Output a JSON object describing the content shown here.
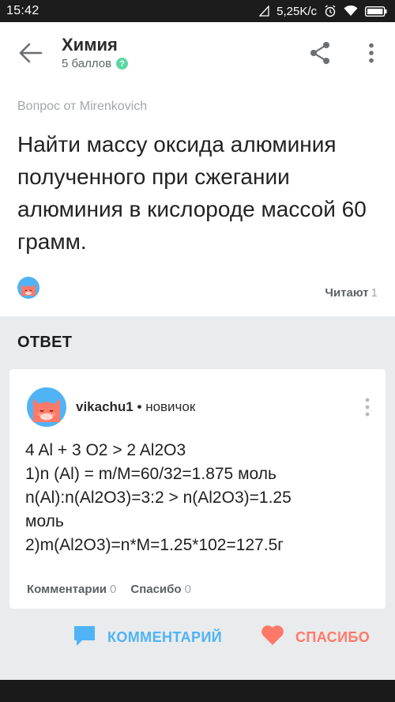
{
  "status_bar": {
    "time": "15:42",
    "speed": "5,25K/c",
    "battery": "",
    "icons": [
      "sim-empty-icon",
      "alarm-icon",
      "wifi-icon",
      "battery-icon"
    ]
  },
  "app_bar": {
    "title": "Химия",
    "points": "5 баллов",
    "help_symbol": "?",
    "icons": [
      "back-arrow-icon",
      "share-icon",
      "more-vertical-icon"
    ]
  },
  "question": {
    "from": "Вопрос от Mirenkovich",
    "text": "Найти массу оксида алюминия полученного при сжегании алюминия в кислороде массой 60 грамм.",
    "readers_label": "Читают",
    "readers_count": "1"
  },
  "answer_section": {
    "header": "ОТВЕТ"
  },
  "answer": {
    "username": "vikachu1",
    "separator": "•",
    "rank": "новичок",
    "lines": [
      "4 Al + 3 O2 > 2 Al2O3",
      "1)n (Al) = m/M=60/32=1.875 моль",
      "n(Al):n(Al2O3)=3:2 > n(Al2O3)=1.25",
      "моль",
      "2)m(Al2O3)=n*M=1.25*102=127.5г"
    ],
    "comments_label": "Комментарии",
    "comments_count": "0",
    "thanks_label": "Спасибо",
    "thanks_count": "0"
  },
  "actions": {
    "comment_label": "КОММЕНТАРИЙ",
    "thanks_label": "СПАСИБО"
  },
  "colors": {
    "accent_blue": "#4fb3f6",
    "accent_red": "#ff7968",
    "accent_green": "#5bd6a4",
    "background": "#e9ebec"
  }
}
